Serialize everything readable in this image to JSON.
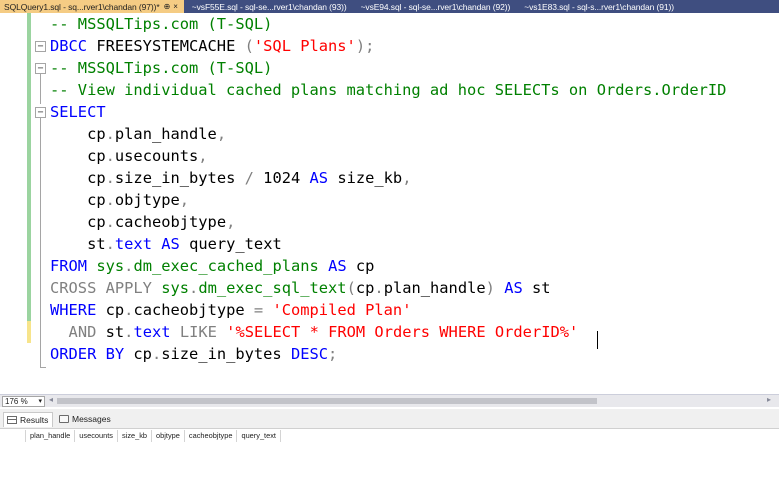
{
  "tabs": [
    {
      "label": "SQLQuery1.sql - sq...rver1\\chandan (97))*",
      "active": true,
      "pin": "⊕",
      "close": "×"
    },
    {
      "label": "~vsF55E.sql - sql-se...rver1\\chandan (93))",
      "active": false
    },
    {
      "label": "~vsE94.sql - sql-se...rver1\\chandan (92))",
      "active": false
    },
    {
      "label": "~vs1E83.sql - sql-s...rver1\\chandan (91))",
      "active": false
    }
  ],
  "editor": {
    "lines": [
      {
        "tokens": [
          {
            "t": "-- MSSQLTips.com (T-SQL)",
            "c": "cm"
          }
        ]
      },
      {
        "tokens": [
          {
            "t": "DBCC",
            "c": "kw"
          },
          {
            "t": " FREESYSTEMCACHE ",
            "c": ""
          },
          {
            "t": "(",
            "c": "gray"
          },
          {
            "t": "'SQL Plans'",
            "c": "str"
          },
          {
            "t": ");",
            "c": "gray"
          }
        ]
      },
      {
        "tokens": [
          {
            "t": "-- MSSQLTips.com (T-SQL)",
            "c": "cm"
          }
        ]
      },
      {
        "tokens": [
          {
            "t": "-- View individual cached plans matching ad hoc SELECTs on Orders.OrderID",
            "c": "cm"
          }
        ]
      },
      {
        "tokens": [
          {
            "t": "SELECT",
            "c": "kw"
          }
        ]
      },
      {
        "tokens": [
          {
            "t": "    cp",
            "c": ""
          },
          {
            "t": ".",
            "c": "gray"
          },
          {
            "t": "plan_handle",
            "c": ""
          },
          {
            "t": ",",
            "c": "gray"
          }
        ]
      },
      {
        "tokens": [
          {
            "t": "    cp",
            "c": ""
          },
          {
            "t": ".",
            "c": "gray"
          },
          {
            "t": "usecounts",
            "c": ""
          },
          {
            "t": ",",
            "c": "gray"
          }
        ]
      },
      {
        "tokens": [
          {
            "t": "    cp",
            "c": ""
          },
          {
            "t": ".",
            "c": "gray"
          },
          {
            "t": "size_in_bytes ",
            "c": ""
          },
          {
            "t": "/",
            "c": "gray"
          },
          {
            "t": " 1024 ",
            "c": ""
          },
          {
            "t": "AS",
            "c": "kw"
          },
          {
            "t": " size_kb",
            "c": ""
          },
          {
            "t": ",",
            "c": "gray"
          }
        ]
      },
      {
        "tokens": [
          {
            "t": "    cp",
            "c": ""
          },
          {
            "t": ".",
            "c": "gray"
          },
          {
            "t": "objtype",
            "c": ""
          },
          {
            "t": ",",
            "c": "gray"
          }
        ]
      },
      {
        "tokens": [
          {
            "t": "    cp",
            "c": ""
          },
          {
            "t": ".",
            "c": "gray"
          },
          {
            "t": "cacheobjtype",
            "c": ""
          },
          {
            "t": ",",
            "c": "gray"
          }
        ]
      },
      {
        "tokens": [
          {
            "t": "    st",
            "c": ""
          },
          {
            "t": ".",
            "c": "gray"
          },
          {
            "t": "text",
            "c": "kw"
          },
          {
            "t": " ",
            "c": ""
          },
          {
            "t": "AS",
            "c": "kw"
          },
          {
            "t": " query_text",
            "c": ""
          }
        ]
      },
      {
        "tokens": [
          {
            "t": "FROM",
            "c": "kw"
          },
          {
            "t": " ",
            "c": ""
          },
          {
            "t": "sys",
            "c": "sys"
          },
          {
            "t": ".",
            "c": "gray"
          },
          {
            "t": "dm_exec_cached_plans",
            "c": "sys"
          },
          {
            "t": " ",
            "c": ""
          },
          {
            "t": "AS",
            "c": "kw"
          },
          {
            "t": " cp",
            "c": ""
          }
        ]
      },
      {
        "tokens": [
          {
            "t": "CROSS APPLY",
            "c": "gray"
          },
          {
            "t": " ",
            "c": ""
          },
          {
            "t": "sys",
            "c": "sys"
          },
          {
            "t": ".",
            "c": "gray"
          },
          {
            "t": "dm_exec_sql_text",
            "c": "sys"
          },
          {
            "t": "(",
            "c": "gray"
          },
          {
            "t": "cp",
            "c": ""
          },
          {
            "t": ".",
            "c": "gray"
          },
          {
            "t": "plan_handle",
            "c": ""
          },
          {
            "t": ")",
            "c": "gray"
          },
          {
            "t": " ",
            "c": ""
          },
          {
            "t": "AS",
            "c": "kw"
          },
          {
            "t": " st",
            "c": ""
          }
        ]
      },
      {
        "tokens": [
          {
            "t": "WHERE",
            "c": "kw"
          },
          {
            "t": " cp",
            "c": ""
          },
          {
            "t": ".",
            "c": "gray"
          },
          {
            "t": "cacheobjtype ",
            "c": ""
          },
          {
            "t": "=",
            "c": "gray"
          },
          {
            "t": " ",
            "c": ""
          },
          {
            "t": "'Compiled Plan'",
            "c": "str"
          }
        ]
      },
      {
        "tokens": [
          {
            "t": "  ",
            "c": ""
          },
          {
            "t": "AND",
            "c": "gray"
          },
          {
            "t": " st",
            "c": ""
          },
          {
            "t": ".",
            "c": "gray"
          },
          {
            "t": "text",
            "c": "kw"
          },
          {
            "t": " ",
            "c": ""
          },
          {
            "t": "LIKE",
            "c": "gray"
          },
          {
            "t": " ",
            "c": ""
          },
          {
            "t": "'%SELECT * FROM Orders WHERE OrderID%'",
            "c": "str"
          }
        ]
      },
      {
        "tokens": [
          {
            "t": "ORDER BY",
            "c": "kw"
          },
          {
            "t": " cp",
            "c": ""
          },
          {
            "t": ".",
            "c": "gray"
          },
          {
            "t": "size_in_bytes ",
            "c": ""
          },
          {
            "t": "DESC",
            "c": "kw"
          },
          {
            "t": ";",
            "c": "gray"
          }
        ]
      }
    ]
  },
  "zoom": {
    "value": "176 %",
    "chevron": "▾"
  },
  "scroll": {
    "left_arrow": "◂",
    "right_arrow": "▸"
  },
  "results": {
    "tabs": [
      {
        "label": "Results",
        "active": true
      },
      {
        "label": "Messages",
        "active": false
      }
    ],
    "columns": [
      "plan_handle",
      "usecounts",
      "size_kb",
      "objtype",
      "cacheobjtype",
      "query_text"
    ]
  }
}
